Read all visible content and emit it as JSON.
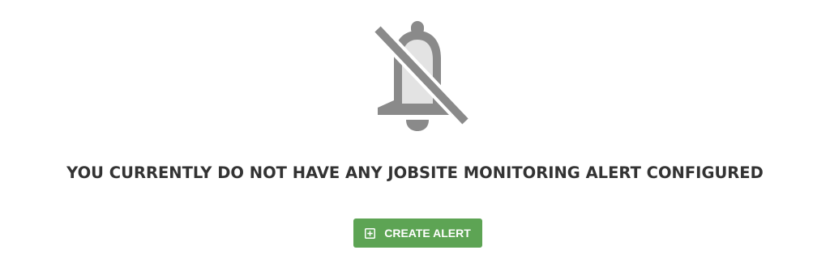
{
  "empty_state": {
    "icon": "bell-slash-icon",
    "message": "YOU CURRENTLY DO NOT HAVE ANY JOBSITE MONITORING ALERT CONFIGURED",
    "create_button": {
      "label": "CREATE ALERT",
      "icon": "plus-square-icon"
    }
  },
  "colors": {
    "icon_gray": "#8a8a8a",
    "icon_fill_light": "#e3e3e3",
    "text": "#333333",
    "button_bg": "#5da454",
    "button_text": "#ffffff"
  }
}
